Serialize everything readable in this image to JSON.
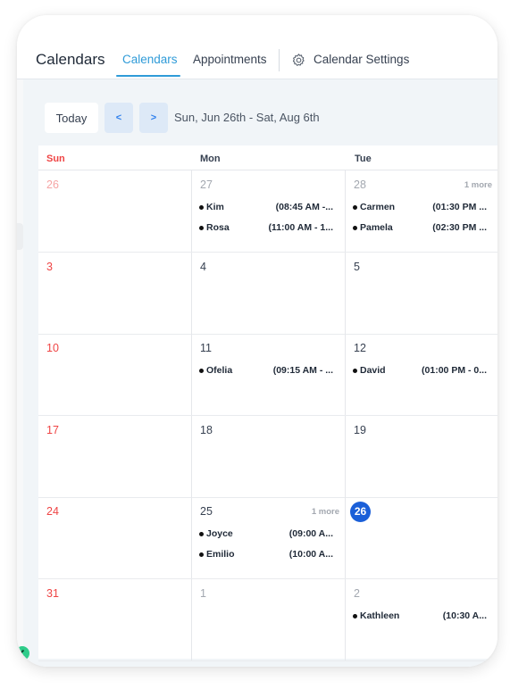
{
  "header": {
    "app_title": "Calendars",
    "tabs": [
      {
        "label": "Calendars",
        "active": true
      },
      {
        "label": "Appointments",
        "active": false
      }
    ],
    "settings_label": "Calendar Settings",
    "settings_icon": "gear-icon"
  },
  "toolbar": {
    "today_label": "Today",
    "prev_label": "<",
    "next_label": ">",
    "range_label": "Sun, Jun 26th - Sat, Aug 6th"
  },
  "calendar": {
    "days_of_week": [
      "Sun",
      "Mon",
      "Tue"
    ],
    "today_color": "#1a5fd8",
    "weekend_color": "#ef4444",
    "weeks": [
      {
        "days": [
          {
            "num": "26",
            "muted": true,
            "events": []
          },
          {
            "num": "27",
            "muted": true,
            "events": [
              {
                "name": "Kim",
                "time": "(08:45 AM -..."
              },
              {
                "name": "Rosa",
                "time": "(11:00 AM - 1..."
              }
            ]
          },
          {
            "num": "28",
            "muted": true,
            "more": "1 more",
            "events": [
              {
                "name": "Carmen",
                "time": "(01:30 PM ..."
              },
              {
                "name": "Pamela",
                "time": "(02:30 PM ..."
              }
            ]
          }
        ]
      },
      {
        "days": [
          {
            "num": "3",
            "events": []
          },
          {
            "num": "4",
            "events": []
          },
          {
            "num": "5",
            "events": []
          }
        ]
      },
      {
        "days": [
          {
            "num": "10",
            "events": []
          },
          {
            "num": "11",
            "events": [
              {
                "name": "Ofelia",
                "time": "(09:15 AM - ..."
              }
            ]
          },
          {
            "num": "12",
            "events": [
              {
                "name": "David",
                "time": "(01:00 PM - 0..."
              }
            ]
          }
        ]
      },
      {
        "days": [
          {
            "num": "17",
            "events": []
          },
          {
            "num": "18",
            "events": []
          },
          {
            "num": "19",
            "events": []
          }
        ]
      },
      {
        "days": [
          {
            "num": "24",
            "events": []
          },
          {
            "num": "25",
            "more": "1 more",
            "events": [
              {
                "name": "Joyce",
                "time": "(09:00 A..."
              },
              {
                "name": "Emilio",
                "time": "(10:00 A..."
              }
            ]
          },
          {
            "num": "26",
            "today": true,
            "events": []
          }
        ]
      },
      {
        "days": [
          {
            "num": "31",
            "events": []
          },
          {
            "num": "1",
            "muted": true,
            "events": []
          },
          {
            "num": "2",
            "muted": true,
            "events": [
              {
                "name": "Kathleen",
                "time": "(10:30 A..."
              }
            ]
          }
        ]
      }
    ]
  },
  "sidebar": {
    "collapse_icon": "chevron-left-icon"
  }
}
